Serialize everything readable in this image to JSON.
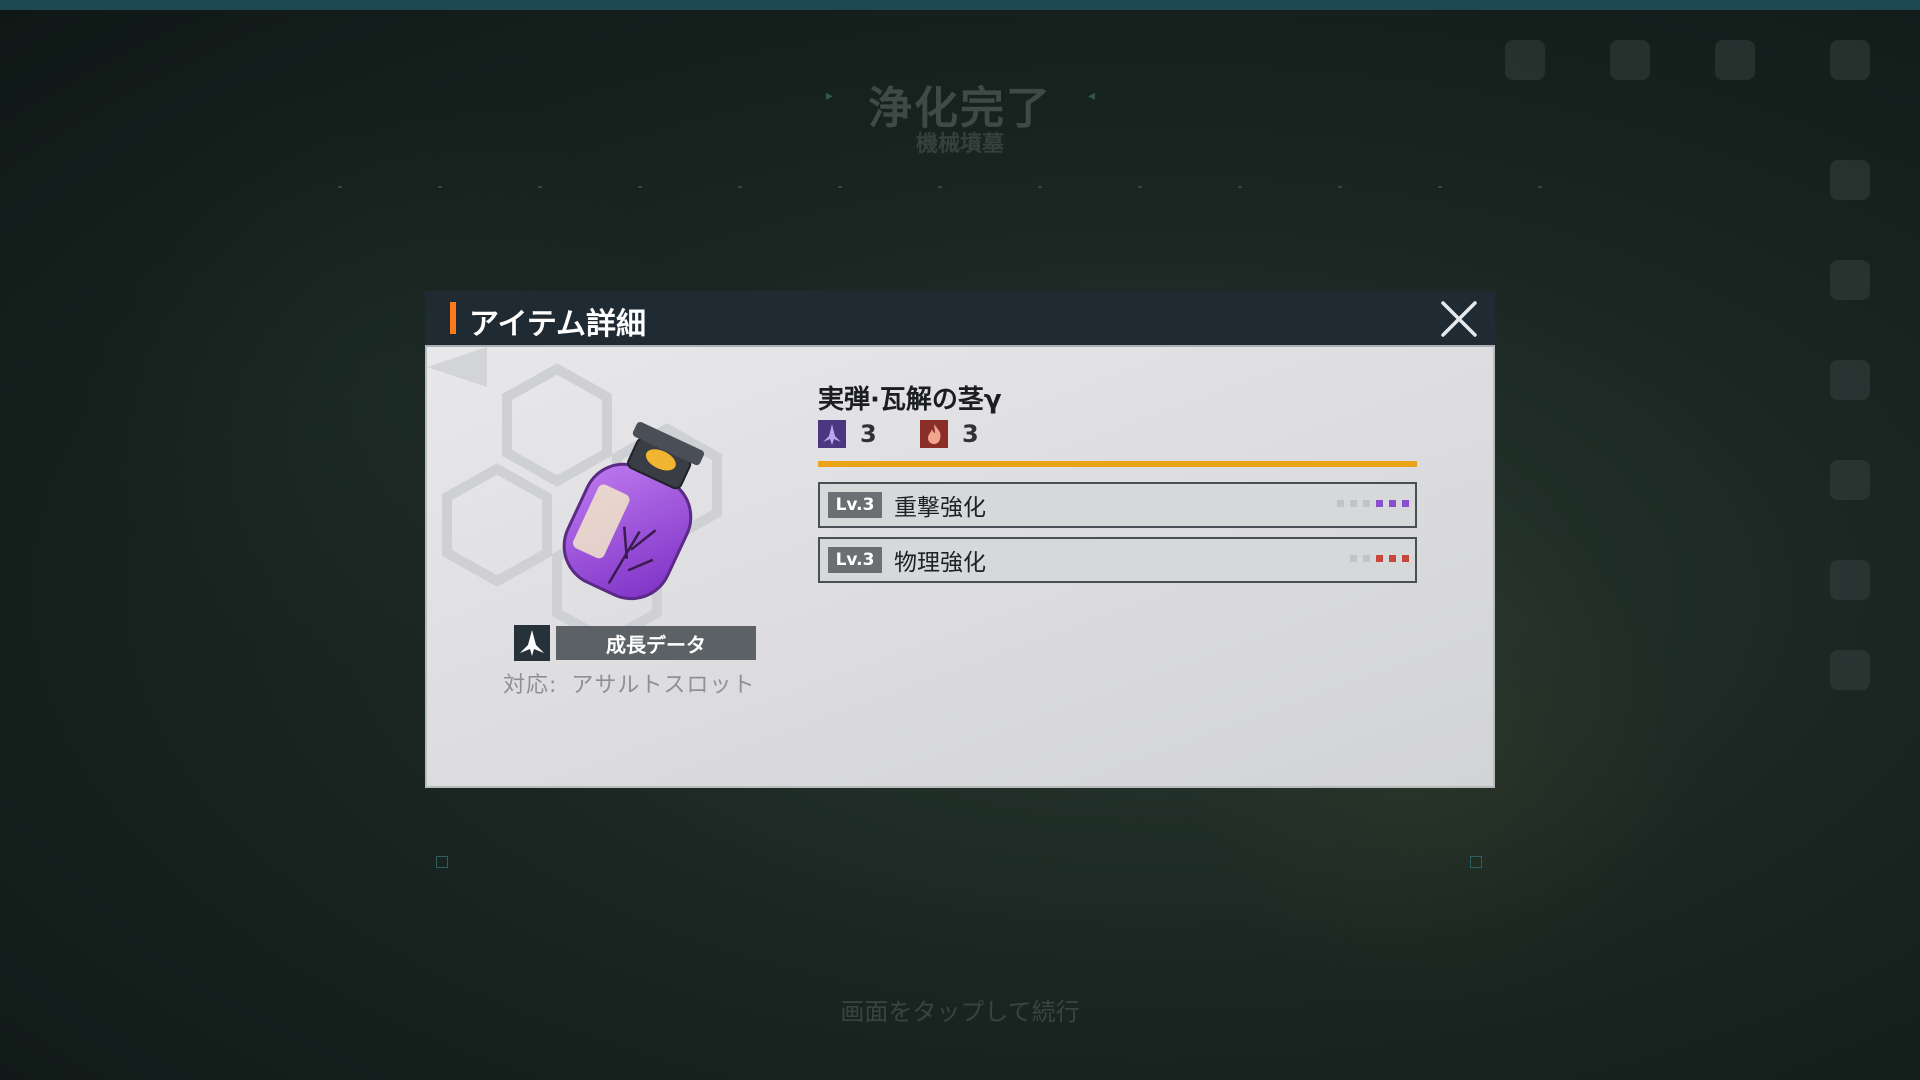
{
  "background": {
    "title": "浄化完了",
    "subtitle": "機械墳墓",
    "tap_hint": "画面をタップして続行"
  },
  "dialog": {
    "title": "アイテム詳細",
    "close_icon": "close-x-icon",
    "item": {
      "name": "実弾·瓦解の茎γ",
      "image_icon": "purple-canister-icon",
      "category_icon": "assault-slot-icon",
      "category_label": "成長データ",
      "compat_label": "対応:",
      "compat_value": "アサルトスロット",
      "stats": [
        {
          "icon": "assault-type-icon",
          "color": "#5a3a8f",
          "value": "3"
        },
        {
          "icon": "fire-type-icon",
          "color": "#c0392b",
          "value": "3"
        }
      ],
      "rarity_color": "#e8a319",
      "effects": [
        {
          "level": "Lv.3",
          "label": "重撃強化",
          "pip_color": "#8a4fd1",
          "pips_filled": 3,
          "pips_total": 6
        },
        {
          "level": "Lv.3",
          "label": "物理強化",
          "pip_color": "#c8463a",
          "pips_filled": 3,
          "pips_total": 5
        }
      ]
    }
  }
}
